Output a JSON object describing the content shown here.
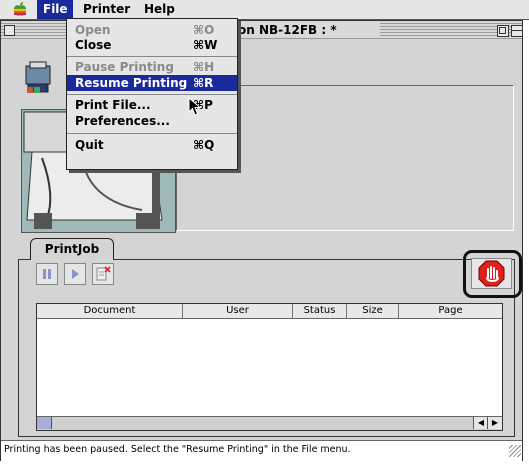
{
  "menubar": {
    "items": [
      {
        "label": "File"
      },
      {
        "label": "Printer"
      },
      {
        "label": "Help"
      }
    ]
  },
  "window": {
    "title": "on NB-12FB : *"
  },
  "file_menu": {
    "items": [
      {
        "label": "Open",
        "shortcut": "⌘O",
        "enabled": false
      },
      {
        "label": "Close",
        "shortcut": "⌘W",
        "enabled": true
      },
      {
        "label": "Pause Printing",
        "shortcut": "⌘H",
        "enabled": false
      },
      {
        "label": "Resume Printing",
        "shortcut": "⌘R",
        "enabled": true,
        "highlighted": true
      },
      {
        "label": "Print File...",
        "shortcut": "⌘P",
        "enabled": true
      },
      {
        "label": "Preferences...",
        "shortcut": "",
        "enabled": true
      },
      {
        "label": "Quit",
        "shortcut": "⌘Q",
        "enabled": true
      }
    ]
  },
  "printjob": {
    "tab_label": "PrintJob",
    "columns": [
      "Document",
      "User",
      "Status",
      "Size",
      "Page"
    ]
  },
  "status": {
    "message": "Printing has been paused. Select the \"Resume Printing\" in the File menu."
  },
  "colors": {
    "highlight": "#1a2a9a",
    "stop_red": "#e0211b"
  }
}
